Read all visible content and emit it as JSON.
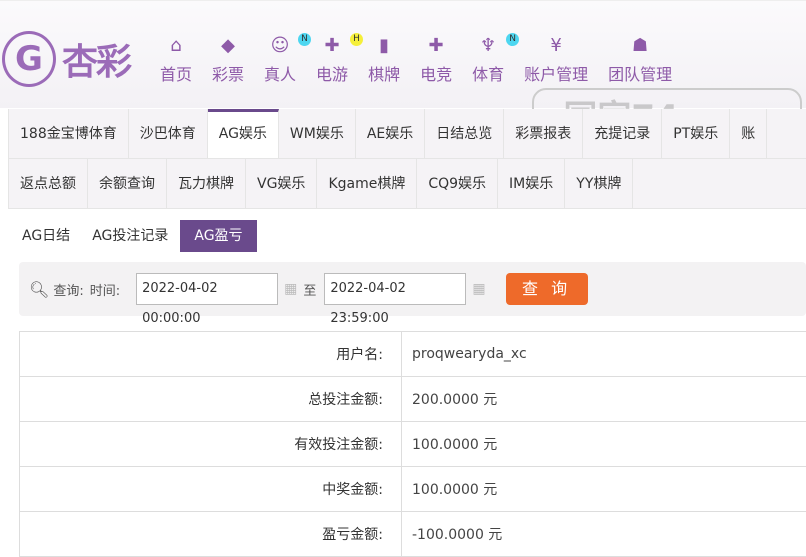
{
  "logo": {
    "text": "杏彩"
  },
  "nav": [
    {
      "label": "首页",
      "icon": "home-icon",
      "glyph": "⌂"
    },
    {
      "label": "彩票",
      "icon": "ticket-icon",
      "glyph": "◆"
    },
    {
      "label": "真人",
      "icon": "live-dealer-icon",
      "glyph": "☺",
      "badge": "N",
      "badge_color": "#4dd6f0"
    },
    {
      "label": "电游",
      "icon": "gamepad-icon",
      "glyph": "✚",
      "badge": "H",
      "badge_color": "#f5ef3a"
    },
    {
      "label": "棋牌",
      "icon": "cards-icon",
      "glyph": "▮"
    },
    {
      "label": "电竞",
      "icon": "esports-icon",
      "glyph": "✚"
    },
    {
      "label": "体育",
      "icon": "trophy-icon",
      "glyph": "♆",
      "badge": "N",
      "badge_color": "#4dd6f0"
    },
    {
      "label": "账户管理",
      "icon": "yen-icon",
      "glyph": "¥"
    },
    {
      "label": "团队管理",
      "icon": "team-icon",
      "glyph": "☗"
    }
  ],
  "tabs_row1": [
    "188金宝博体育",
    "沙巴体育",
    "AG娱乐",
    "WM娱乐",
    "AE娱乐",
    "日结总览",
    "彩票报表",
    "充提记录",
    "PT娱乐",
    "账"
  ],
  "tabs_row2": [
    "返点总额",
    "余额查询",
    "瓦力棋牌",
    "VG娱乐",
    "Kgame棋牌",
    "CQ9娱乐",
    "IM娱乐",
    "YY棋牌"
  ],
  "active_tab": "AG娱乐",
  "subtabs": [
    "AG日结",
    "AG投注记录",
    "AG盈亏"
  ],
  "active_subtab": "AG盈亏",
  "query": {
    "label": "查询:",
    "time_label": "时间:",
    "start": "2022-04-02 00:00:00",
    "to": "至",
    "end": "2022-04-02 23:59:00",
    "button": "查 询"
  },
  "rows": [
    {
      "label": "用户名:",
      "value": "proqwearyda_xc"
    },
    {
      "label": "总投注金额:",
      "value": "200.0000 元"
    },
    {
      "label": "有效投注金额:",
      "value": "100.0000 元"
    },
    {
      "label": "中奖金额:",
      "value": "100.0000 元"
    },
    {
      "label": "盈亏金额:",
      "value": "-100.0000 元"
    }
  ],
  "watermark": "同家74.com"
}
